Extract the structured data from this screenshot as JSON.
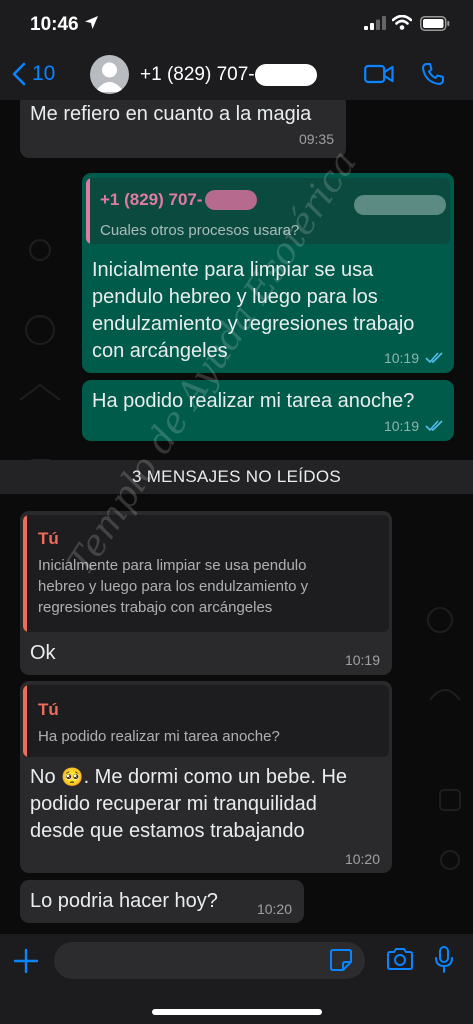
{
  "status_bar": {
    "time": "10:46"
  },
  "header": {
    "back_count": "10",
    "contact_name": "+1 (829) 707-"
  },
  "messages": {
    "m1": {
      "text": "Me refiero en cuanto a la magia",
      "time": "09:35"
    },
    "m2": {
      "quote_name": "+1 (829) 707-",
      "quote_text": "Cuales otros procesos usara?",
      "line1": "Inicialmente para limpiar se usa",
      "line2": "pendulo hebreo y luego para los",
      "line3": "endulzamiento y regresiones trabajo",
      "line4": "con arcángeles",
      "time": "10:19"
    },
    "m3": {
      "text": "Ha podido realizar mi tarea anoche?",
      "time": "10:19"
    },
    "unread_divider": "3 MENSAJES NO LEÍDOS",
    "m4": {
      "quote_name": "Tú",
      "quote_line1": "Inicialmente para limpiar se usa pendulo",
      "quote_line2": "hebreo y luego para los endulzamiento y",
      "quote_line3": "regresiones trabajo con arcángeles",
      "text": "Ok",
      "time": "10:19"
    },
    "m5": {
      "quote_name": "Tú",
      "quote_text": "Ha podido realizar mi tarea anoche?",
      "line1_a": "No",
      "emoji": "🥺",
      "line1_b": ". Me dormi como un bebe. He",
      "line2": "podido recuperar mi tranquilidad",
      "line3": "desde que estamos trabajando",
      "time": "10:20"
    },
    "m6": {
      "text": "Lo podria hacer hoy?",
      "time": "10:20"
    }
  },
  "watermark": "Templo de Ayuda Esotérica",
  "colors": {
    "accent": "#0a84ff",
    "outgoing_bubble": "#005b4a",
    "incoming_bubble": "#2a2a2c",
    "quote_self": "#ef6b5b",
    "quote_contact": "#e07ba4",
    "read_ticks": "#53bdeb"
  },
  "icons": [
    "location-arrow-icon",
    "signal-icon",
    "wifi-icon",
    "battery-icon",
    "chevron-left-icon",
    "avatar-icon",
    "video-call-icon",
    "phone-icon",
    "plus-icon",
    "sticker-icon",
    "camera-icon",
    "microphone-icon",
    "double-check-icon"
  ]
}
